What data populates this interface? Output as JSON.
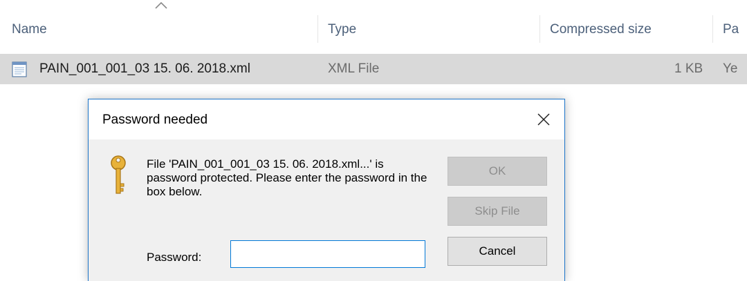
{
  "list": {
    "columns": [
      {
        "label": "Name"
      },
      {
        "label": "Type"
      },
      {
        "label": "Compressed size"
      },
      {
        "label": "Pa"
      }
    ],
    "sort_indicator": "sort-ascending-icon",
    "rows": [
      {
        "name": "PAIN_001_001_03 15. 06. 2018.xml",
        "type": "XML File",
        "compressed_size": "1 KB",
        "password_protected": "Ye",
        "icon": "xml-file-icon"
      }
    ]
  },
  "dialog": {
    "title": "Password needed",
    "close_icon": "close-icon",
    "icon": "key-icon",
    "message": "File 'PAIN_001_001_03 15. 06. 2018.xml...' is password protected.  Please enter the password in the box below.",
    "buttons": {
      "ok": "OK",
      "skip": "Skip File",
      "cancel": "Cancel"
    },
    "password_label": "Password:",
    "password_value": ""
  },
  "colors": {
    "dialog_border": "#1a73c8",
    "input_border": "#0078d7",
    "row_selected": "#d9d9d9",
    "header_text": "#4c607a"
  }
}
